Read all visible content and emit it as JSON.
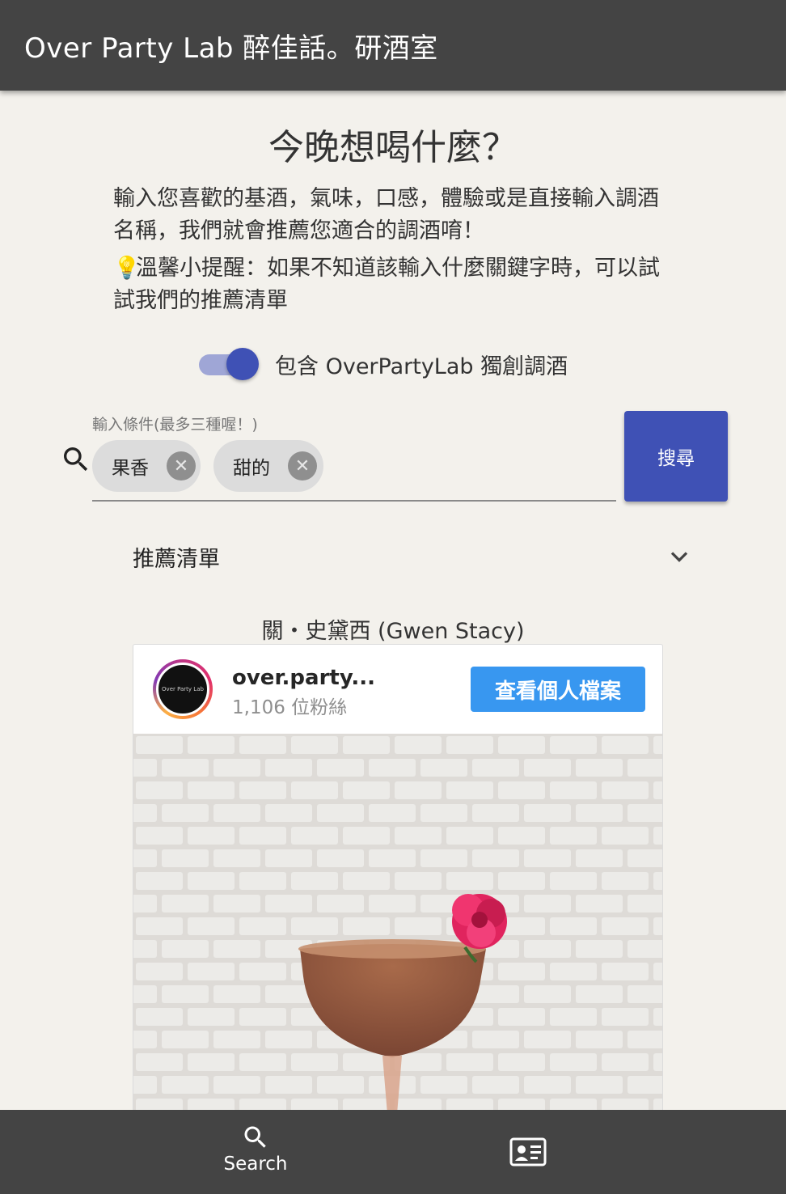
{
  "app_bar": {
    "title": "Over Party Lab 醉佳話。研酒室"
  },
  "main": {
    "heading": "今晚想喝什麼？",
    "intro": "輸入您喜歡的基酒，氣味，口感，體驗或是直接輸入調酒名稱，我們就會推薦您適合的調酒唷！",
    "tip_icon": "lightbulb-icon",
    "tip": "溫馨小提醒：如果不知道該輸入什麼關鍵字時，可以試試我們的推薦清單"
  },
  "toggle": {
    "label": "包含 OverPartyLab 獨創調酒",
    "checked": true,
    "color": "#3f51b5"
  },
  "search": {
    "field_label": "輸入條件(最多三種喔！)",
    "chips": [
      {
        "label": "果香"
      },
      {
        "label": "甜的"
      }
    ],
    "button_label": "搜尋",
    "button_color": "#3f51b5"
  },
  "recommendation": {
    "title": "推薦清單",
    "expanded": false
  },
  "featured": {
    "cocktail_name": "關・史黛西 (Gwen Stacy)",
    "instagram": {
      "username": "over.party...",
      "followers": "1,106 位粉絲",
      "profile_button": "查看個人檔案",
      "avatar_text": "Over Party Lab",
      "button_color": "#3897f0"
    }
  },
  "bottom_nav": {
    "search_label": "Search",
    "contact_icon": "contact-card-icon"
  }
}
